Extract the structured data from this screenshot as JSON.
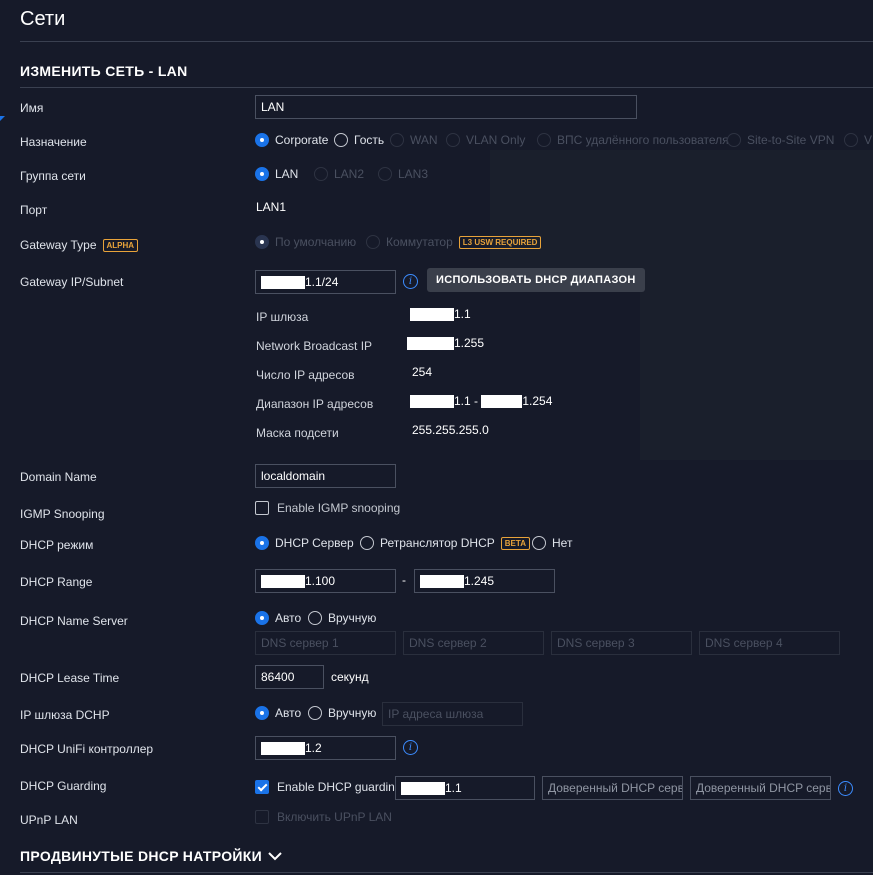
{
  "page": {
    "title": "Сети"
  },
  "section_title": "ИЗМЕНИТЬ СЕТЬ - LAN",
  "fields": {
    "name": {
      "label": "Имя",
      "value": "LAN"
    },
    "purpose": {
      "label": "Назначение",
      "options": [
        "Corporate",
        "Гость",
        "WAN",
        "VLAN Only",
        "ВПС удалённого пользователя",
        "Site-to-Site VPN",
        "V"
      ]
    },
    "network_group": {
      "label": "Группа сети",
      "options": [
        "LAN",
        "LAN2",
        "LAN3"
      ]
    },
    "port": {
      "label": "Порт",
      "value": "LAN1"
    },
    "gateway_type": {
      "label": "Gateway Type",
      "badge": "ALPHA",
      "options": [
        "По умолчанию",
        "Коммутатор"
      ],
      "switch_badge": "L3 USW REQUIRED"
    },
    "gateway_ip": {
      "label": "Gateway IP/Subnet",
      "value_suffix": "1.1/24",
      "button": "ИСПОЛЬЗОВАТЬ DHCP ДИАПАЗОН",
      "details": [
        {
          "label": "IP шлюза",
          "value": "1.1"
        },
        {
          "label": "Network Broadcast IP",
          "value": "1.255"
        },
        {
          "label": "Число IP адресов",
          "value": "254"
        },
        {
          "label": "Диапазон IP адресов",
          "value_a": "1.1 -",
          "value_b": "1.254"
        },
        {
          "label": "Маска подсети",
          "value": "255.255.255.0"
        }
      ]
    },
    "domain_name": {
      "label": "Domain Name",
      "value": "localdomain"
    },
    "igmp": {
      "label": "IGMP Snooping",
      "checkbox": "Enable IGMP snooping"
    },
    "dhcp_mode": {
      "label": "DHCP режим",
      "options": [
        "DHCP Сервер",
        "Ретранслятор DHCP",
        "Нет"
      ],
      "relay_badge": "BETA"
    },
    "dhcp_range": {
      "label": "DHCP Range",
      "start_suffix": "1.100",
      "separator": "-",
      "end_suffix": "1.245"
    },
    "dhcp_name_server": {
      "label": "DHCP Name Server",
      "options": [
        "Авто",
        "Вручную"
      ],
      "placeholders": [
        "DNS сервер 1",
        "DNS сервер 2",
        "DNS сервер 3",
        "DNS сервер 4"
      ]
    },
    "lease_time": {
      "label": "DHCP Lease Time",
      "value": "86400",
      "unit": "секунд"
    },
    "gateway_dhcp": {
      "label": "IP шлюза DCHP",
      "options": [
        "Авто",
        "Вручную"
      ],
      "placeholder": "IP адреса шлюза"
    },
    "unifi_controller": {
      "label": "DHCP UniFi контроллер",
      "value_suffix": "1.2"
    },
    "dhcp_guarding": {
      "label": "DHCP Guarding",
      "checkbox": "Enable DHCP guarding",
      "value_suffix": "1.1",
      "trusted_1": "Доверенный DHCP серве",
      "trusted_2": "Доверенный DHCP серве"
    },
    "upnp": {
      "label": "UPnP LAN",
      "checkbox": "Включить UPnP LAN"
    }
  },
  "advanced": {
    "title": "ПРОДВИНУТЫЕ DHCP НАТРОЙКИ"
  },
  "icons": {
    "info": "info-icon",
    "chevron": "chevron-down-icon",
    "accent": "#1a73e8"
  }
}
